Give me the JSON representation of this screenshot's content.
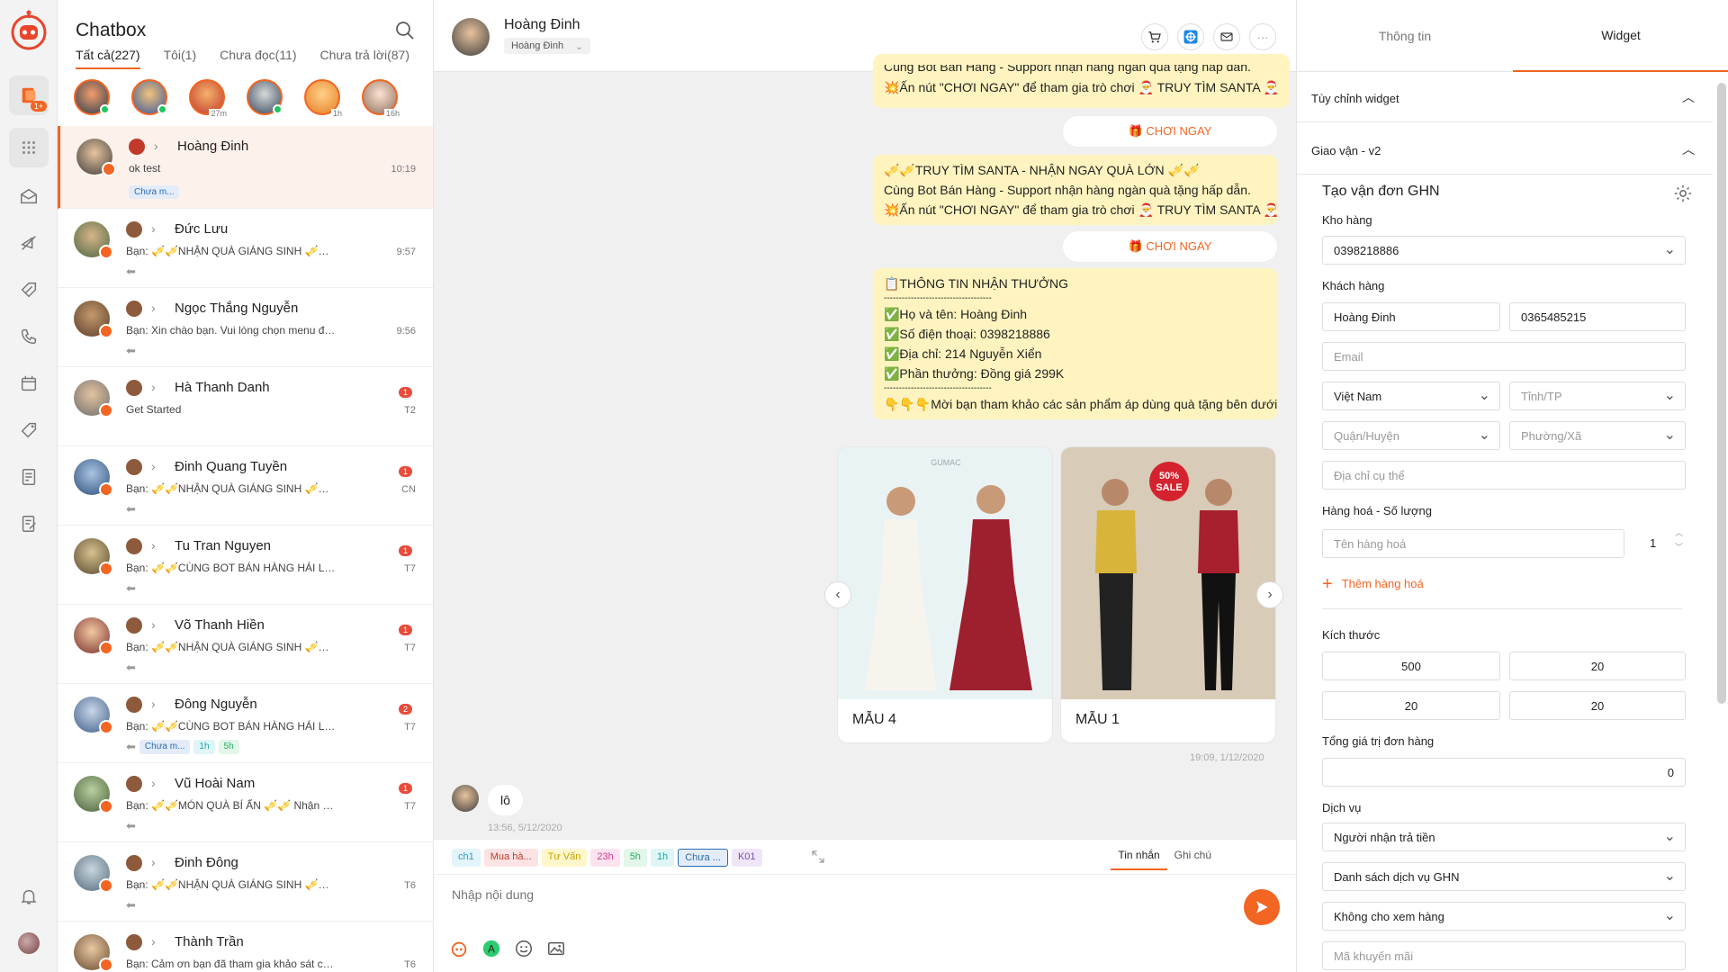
{
  "rail": {
    "badge": "1+"
  },
  "list": {
    "title": "Chatbox",
    "filters": [
      "Tất cả(227)",
      "Tôi(1)",
      "Chưa đọc(11)",
      "Chưa trả lời(87)"
    ],
    "stories": [
      {
        "online": true,
        "time": ""
      },
      {
        "online": true,
        "time": ""
      },
      {
        "online": false,
        "time": "27m"
      },
      {
        "online": true,
        "time": ""
      },
      {
        "online": false,
        "time": "1h"
      },
      {
        "online": false,
        "time": "16h"
      }
    ],
    "conversations": [
      {
        "name": "Hoàng Đinh",
        "message": "ok test",
        "time": "10:19",
        "unread": "",
        "tags": [
          "Chưa m..."
        ]
      },
      {
        "name": "Đức Lưu",
        "message": "Bạn: 🎺🎺NHẬN QUÀ GIÁNG SINH 🎺🎺 ...",
        "time": "9:57",
        "unread": "",
        "tags": []
      },
      {
        "name": "Ngọc Thắng Nguyễn",
        "message": "Bạn: Xin chào bạn. Vui lòng chọn menu để ...",
        "time": "9:56",
        "unread": "",
        "tags": []
      },
      {
        "name": "Hà Thanh Danh",
        "message": "Get Started",
        "time": "T2",
        "unread": "1",
        "tags": []
      },
      {
        "name": "Đinh Quang Tuyền",
        "message": "Bạn: 🎺🎺NHẬN QUÀ GIÁNG SINH 🎺🎺 ...",
        "time": "CN",
        "unread": "1",
        "tags": []
      },
      {
        "name": "Tu Tran Nguyen",
        "message": "Bạn: 🎺🎺CÙNG BOT BÁN HÀNG HÁI LỘC...",
        "time": "T7",
        "unread": "1",
        "tags": []
      },
      {
        "name": "Võ Thanh Hiền",
        "message": "Bạn: 🎺🎺NHẬN QUÀ GIÁNG SINH 🎺🎺 ...",
        "time": "T7",
        "unread": "1",
        "tags": []
      },
      {
        "name": "Đông Nguyễn",
        "message": "Bạn: 🎺🎺CÙNG BOT BÁN HÀNG HÁI LỘC...",
        "time": "T7",
        "unread": "2",
        "tags": [
          "Chưa m...",
          "1h",
          "5h"
        ]
      },
      {
        "name": "Vũ Hoài Nam",
        "message": "Bạn: 🎺🎺MÓN QUÀ BÍ ẨN 🎺🎺 Nhận hà...",
        "time": "T7",
        "unread": "1",
        "tags": []
      },
      {
        "name": "Đinh Đông",
        "message": "Bạn: 🎺🎺NHẬN QUÀ GIÁNG SINH 🎺🎺 ...",
        "time": "T6",
        "unread": "",
        "tags": []
      },
      {
        "name": "Thành Trần",
        "message": "Bạn: Cảm ơn bạn đã tham gia khảo sát của ...",
        "time": "T6",
        "unread": "",
        "tags": []
      }
    ]
  },
  "chat": {
    "contact_name": "Hoàng Đinh",
    "page_name": "Hoàng Đinh",
    "bubble1_line1": "Cùng Bot Bán Hàng - Support nhận hàng ngàn quà tặng hấp dẫn.",
    "bubble1_line2": "💥Ấn nút \"CHƠI NGAY\" để tham gia trò chơi 🎅 TRUY TÌM SANTA 🎅",
    "play_button": "🎁 CHƠI NGAY",
    "bubble2_line1": "🎺🎺TRUY TÌM SANTA - NHẬN NGAY QUÀ LỚN 🎺🎺",
    "bubble2_line2": "Cùng Bot Bán Hàng - Support nhận hàng ngàn quà tặng hấp dẫn.",
    "bubble2_line3": "💥Ấn nút \"CHƠI NGAY\" để tham gia trò chơi 🎅 TRUY TÌM SANTA 🎅",
    "info_lines": [
      "📋THÔNG TIN NHẬN THƯỞNG",
      "------------------------------------",
      "✅Họ và tên: Hoàng Đinh",
      "✅Số điện thoại: 0398218886",
      "✅Địa chỉ: 214 Nguyễn Xiển",
      "✅Phần thưởng: Đồng giá 299K",
      "------------------------------------",
      "👇👇👇Mời bạn tham khảo các sản phẩm áp dùng quà tặng bên dưới"
    ],
    "cards": [
      {
        "label": "MẪU 4",
        "brand": "GUMAC"
      },
      {
        "label": "MẪU 1",
        "sale": "50% SALE"
      }
    ],
    "out_time": "19:09, 1/12/2020",
    "incoming_text": "lô",
    "incoming_time": "13:56, 5/12/2020",
    "quick_tags": [
      {
        "label": "ch1",
        "color": "#2aa0c8",
        "bg": "#e3f4fa"
      },
      {
        "label": "Mua hà...",
        "color": "#c0392b",
        "bg": "#fde3e3"
      },
      {
        "label": "Tư Vấn",
        "color": "#c9a300",
        "bg": "#fff6cc"
      },
      {
        "label": "23h",
        "color": "#d23c8c",
        "bg": "#fde3f0"
      },
      {
        "label": "5h",
        "color": "#27ae60",
        "bg": "#e2f6ea"
      },
      {
        "label": "1h",
        "color": "#1aa6a6",
        "bg": "#e0f5f5"
      },
      {
        "label": "Chưa ...",
        "color": "#2b6cb0",
        "bg": "#e3ecf8"
      },
      {
        "label": "K01",
        "color": "#7a4fb5",
        "bg": "#efe6f8"
      }
    ],
    "composer_tab_message": "Tin nhắn",
    "composer_tab_note": "Ghi chú",
    "composer_placeholder": "Nhập nội dung"
  },
  "panel": {
    "tab_info": "Thông tin",
    "tab_widget": "Widget",
    "section_custom": "Tùy chỉnh widget",
    "section_shipping": "Giao vận - v2",
    "form_title": "Tạo vận đơn GHN",
    "warehouse_label": "Kho hàng",
    "warehouse_value": "0398218886",
    "customer_label": "Khách hàng",
    "customer_name": "Hoàng Đinh",
    "customer_phone": "0365485215",
    "email_placeholder": "Email",
    "country": "Việt Nam",
    "province_placeholder": "Tỉnh/TP",
    "district_placeholder": "Quận/Huyện",
    "ward_placeholder": "Phường/Xã",
    "address_placeholder": "Địa chỉ cụ thể",
    "goods_label": "Hàng hoá - Số lượng",
    "goods_placeholder": "Tên hàng hoá",
    "goods_qty": "1",
    "add_goods": "Thêm hàng hoá",
    "size_label": "Kích thước",
    "size_values": [
      "500",
      "20",
      "20",
      "20"
    ],
    "total_label": "Tổng giá trị đơn hàng",
    "total_value": "0",
    "service_label": "Dịch vụ",
    "payer": "Người nhận trả tiền",
    "service_list": "Danh sách dịch vụ GHN",
    "view_option": "Không cho xem hàng",
    "coupon_placeholder": "Mã khuyến mãi"
  }
}
